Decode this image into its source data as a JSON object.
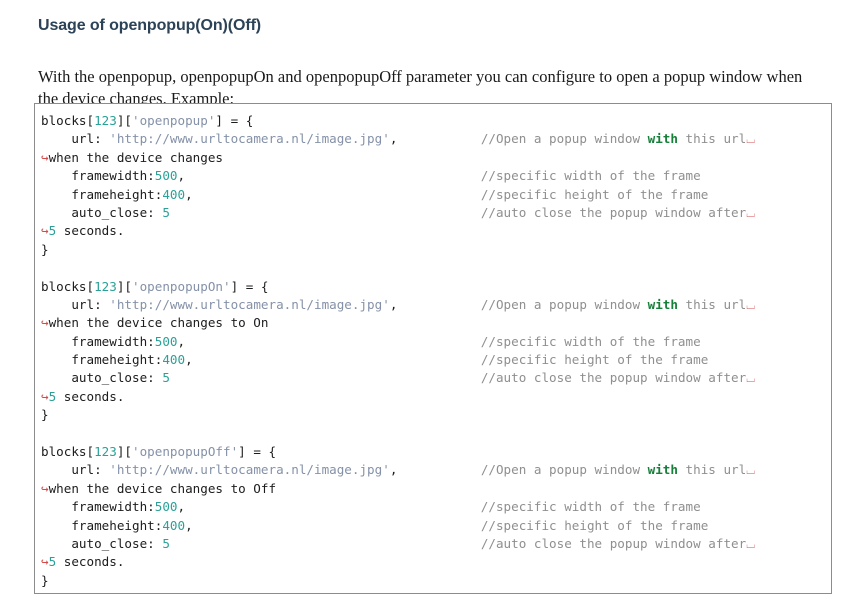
{
  "page": {
    "title": "Usage of openpopup(On)(Off)",
    "intro": "With the openpopup, openpopupOn and openpopupOff parameter you can configure to open a popup window when the device changes. Example:"
  },
  "colors": {
    "title": "#2b4257",
    "body_text": "#1a1a1a",
    "code_text": "#1c1c1c",
    "comment": "#8f8f8f",
    "keyword_bold": "#16803a",
    "number": "#2aa198",
    "string": "#8491a8",
    "wrap_marker": "#d24b4b",
    "box_border": "#8c8c8c",
    "background": "#ffffff"
  },
  "icons": {
    "wrap_arrow": "↪",
    "wrap_tail": "⌴"
  },
  "code": {
    "language": "javascript",
    "blocks": [
      {
        "id": "openpopup",
        "lines": [
          {
            "kind": "code",
            "prefix": "",
            "segments": [
              {
                "t": "blocks[",
                "c": "plain"
              },
              {
                "t": "123",
                "c": "num"
              },
              {
                "t": "][",
                "c": "plain"
              },
              {
                "t": "'openpopup'",
                "c": "str"
              },
              {
                "t": "] = {",
                "c": "plain"
              }
            ],
            "comment": null,
            "comment_bold": null,
            "comment_after": null,
            "tail": false
          },
          {
            "kind": "code",
            "prefix": "    ",
            "segments": [
              {
                "t": "url: ",
                "c": "plain"
              },
              {
                "t": "'http://www.urltocamera.nl/image.jpg'",
                "c": "str"
              },
              {
                "t": ",",
                "c": "plain"
              }
            ],
            "comment": "//Open a popup window ",
            "comment_bold": "with",
            "comment_after": " this url",
            "tail": true
          },
          {
            "kind": "wrap",
            "text": "when the device changes",
            "comment": null
          },
          {
            "kind": "code",
            "prefix": "    ",
            "segments": [
              {
                "t": "framewidth:",
                "c": "plain"
              },
              {
                "t": "500",
                "c": "num"
              },
              {
                "t": ",",
                "c": "plain"
              }
            ],
            "comment": "//specific width of the frame",
            "comment_bold": null,
            "comment_after": null,
            "tail": false
          },
          {
            "kind": "code",
            "prefix": "    ",
            "segments": [
              {
                "t": "frameheight:",
                "c": "plain"
              },
              {
                "t": "400",
                "c": "num"
              },
              {
                "t": ",",
                "c": "plain"
              }
            ],
            "comment": "//specific height of the frame",
            "comment_bold": null,
            "comment_after": null,
            "tail": false
          },
          {
            "kind": "code",
            "prefix": "    ",
            "segments": [
              {
                "t": "auto_close: ",
                "c": "plain"
              },
              {
                "t": "5",
                "c": "num"
              }
            ],
            "comment": "//auto close the popup window after",
            "comment_bold": null,
            "comment_after": null,
            "tail": true
          },
          {
            "kind": "wrap",
            "text": "5 seconds.",
            "num_prefix": "5",
            "comment": null
          },
          {
            "kind": "code",
            "prefix": "",
            "segments": [
              {
                "t": "}",
                "c": "plain"
              }
            ],
            "comment": null,
            "comment_bold": null,
            "comment_after": null,
            "tail": false
          }
        ]
      },
      {
        "id": "openpopupOn",
        "lines": [
          {
            "kind": "code",
            "prefix": "",
            "segments": [
              {
                "t": "blocks[",
                "c": "plain"
              },
              {
                "t": "123",
                "c": "num"
              },
              {
                "t": "][",
                "c": "plain"
              },
              {
                "t": "'openpopupOn'",
                "c": "str"
              },
              {
                "t": "] = {",
                "c": "plain"
              }
            ],
            "comment": null,
            "comment_bold": null,
            "comment_after": null,
            "tail": false
          },
          {
            "kind": "code",
            "prefix": "    ",
            "segments": [
              {
                "t": "url: ",
                "c": "plain"
              },
              {
                "t": "'http://www.urltocamera.nl/image.jpg'",
                "c": "str"
              },
              {
                "t": ",",
                "c": "plain"
              }
            ],
            "comment": "//Open a popup window ",
            "comment_bold": "with",
            "comment_after": " this url",
            "tail": true
          },
          {
            "kind": "wrap",
            "text": "when the device changes to On",
            "comment": null
          },
          {
            "kind": "code",
            "prefix": "    ",
            "segments": [
              {
                "t": "framewidth:",
                "c": "plain"
              },
              {
                "t": "500",
                "c": "num"
              },
              {
                "t": ",",
                "c": "plain"
              }
            ],
            "comment": "//specific width of the frame",
            "comment_bold": null,
            "comment_after": null,
            "tail": false
          },
          {
            "kind": "code",
            "prefix": "    ",
            "segments": [
              {
                "t": "frameheight:",
                "c": "plain"
              },
              {
                "t": "400",
                "c": "num"
              },
              {
                "t": ",",
                "c": "plain"
              }
            ],
            "comment": "//specific height of the frame",
            "comment_bold": null,
            "comment_after": null,
            "tail": false
          },
          {
            "kind": "code",
            "prefix": "    ",
            "segments": [
              {
                "t": "auto_close: ",
                "c": "plain"
              },
              {
                "t": "5",
                "c": "num"
              }
            ],
            "comment": "//auto close the popup window after",
            "comment_bold": null,
            "comment_after": null,
            "tail": true
          },
          {
            "kind": "wrap",
            "text": "5 seconds.",
            "num_prefix": "5",
            "comment": null
          },
          {
            "kind": "code",
            "prefix": "",
            "segments": [
              {
                "t": "}",
                "c": "plain"
              }
            ],
            "comment": null,
            "comment_bold": null,
            "comment_after": null,
            "tail": false
          }
        ]
      },
      {
        "id": "openpopupOff",
        "lines": [
          {
            "kind": "code",
            "prefix": "",
            "segments": [
              {
                "t": "blocks[",
                "c": "plain"
              },
              {
                "t": "123",
                "c": "num"
              },
              {
                "t": "][",
                "c": "plain"
              },
              {
                "t": "'openpopupOff'",
                "c": "str"
              },
              {
                "t": "] = {",
                "c": "plain"
              }
            ],
            "comment": null,
            "comment_bold": null,
            "comment_after": null,
            "tail": false
          },
          {
            "kind": "code",
            "prefix": "    ",
            "segments": [
              {
                "t": "url: ",
                "c": "plain"
              },
              {
                "t": "'http://www.urltocamera.nl/image.jpg'",
                "c": "str"
              },
              {
                "t": ",",
                "c": "plain"
              }
            ],
            "comment": "//Open a popup window ",
            "comment_bold": "with",
            "comment_after": " this url",
            "tail": true
          },
          {
            "kind": "wrap",
            "text": "when the device changes to Off",
            "comment": null
          },
          {
            "kind": "code",
            "prefix": "    ",
            "segments": [
              {
                "t": "framewidth:",
                "c": "plain"
              },
              {
                "t": "500",
                "c": "num"
              },
              {
                "t": ",",
                "c": "plain"
              }
            ],
            "comment": "//specific width of the frame",
            "comment_bold": null,
            "comment_after": null,
            "tail": false
          },
          {
            "kind": "code",
            "prefix": "    ",
            "segments": [
              {
                "t": "frameheight:",
                "c": "plain"
              },
              {
                "t": "400",
                "c": "num"
              },
              {
                "t": ",",
                "c": "plain"
              }
            ],
            "comment": "//specific height of the frame",
            "comment_bold": null,
            "comment_after": null,
            "tail": false
          },
          {
            "kind": "code",
            "prefix": "    ",
            "segments": [
              {
                "t": "auto_close: ",
                "c": "plain"
              },
              {
                "t": "5",
                "c": "num"
              }
            ],
            "comment": "//auto close the popup window after",
            "comment_bold": null,
            "comment_after": null,
            "tail": true
          },
          {
            "kind": "wrap",
            "text": "5 seconds.",
            "num_prefix": "5",
            "comment": null
          },
          {
            "kind": "code",
            "prefix": "",
            "segments": [
              {
                "t": "}",
                "c": "plain"
              }
            ],
            "comment": null,
            "comment_bold": null,
            "comment_after": null,
            "tail": false
          }
        ]
      }
    ]
  }
}
